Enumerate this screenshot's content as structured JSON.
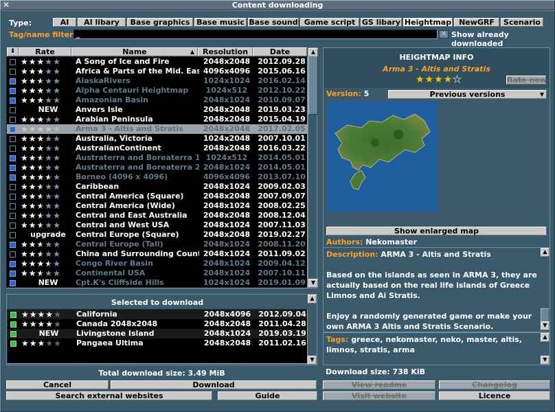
{
  "window": {
    "title": "Content downloading",
    "close_glyph": "✕"
  },
  "filter": {
    "type_label": "Type:",
    "types": [
      {
        "label": "AI",
        "selected": false
      },
      {
        "label": "AI libary",
        "selected": false
      },
      {
        "label": "Base graphics",
        "selected": false
      },
      {
        "label": "Base music",
        "selected": false
      },
      {
        "label": "Base sound",
        "selected": false
      },
      {
        "label": "Game script",
        "selected": false
      },
      {
        "label": "GS libary",
        "selected": false
      },
      {
        "label": "Heightmap",
        "selected": true
      },
      {
        "label": "NewGRF",
        "selected": false
      },
      {
        "label": "Scenario",
        "selected": false
      }
    ],
    "tag_label": "Tag/name filter:",
    "tag_value": "_",
    "show_downloaded_label": "Show already downloaded"
  },
  "list": {
    "columns": {
      "sort": "⬇",
      "rate": "Rate",
      "name": "Name",
      "resolution": "Resolution",
      "date": "Date"
    },
    "items": [
      {
        "checked": false,
        "status": "",
        "rating": 3,
        "name": "A Song of Ice and Fire",
        "resolution": "2048x2048",
        "date": "2012.09.28",
        "downloaded": false
      },
      {
        "checked": false,
        "status": "",
        "rating": 3,
        "name": "Africa & Parts of the Mid. East",
        "resolution": "4096x4096",
        "date": "2015.06.16",
        "downloaded": false
      },
      {
        "checked": true,
        "status": "",
        "rating": 2.5,
        "name": "AlaskaRivers",
        "resolution": "1024x1024",
        "date": "2016.02.14",
        "downloaded": true
      },
      {
        "checked": true,
        "status": "",
        "rating": 3,
        "name": "Alpha Centauri Heightmap",
        "resolution": "1024x512",
        "date": "2012.10.22",
        "downloaded": true
      },
      {
        "checked": true,
        "status": "",
        "rating": 3,
        "name": "Amazonian Basin",
        "resolution": "2048x1024",
        "date": "2010.09.07",
        "downloaded": true
      },
      {
        "checked": false,
        "status": "NEW",
        "rating": 0,
        "name": "Anvers Isle",
        "resolution": "2048x2048",
        "date": "2019.03.23",
        "downloaded": false
      },
      {
        "checked": false,
        "status": "",
        "rating": 3,
        "name": "Arabian Peninsula",
        "resolution": "2048x2048",
        "date": "2015.04.19",
        "downloaded": false
      },
      {
        "checked": true,
        "status": "",
        "rating": 4,
        "name": "Arma 3 - Altis and Stratis",
        "resolution": "2048x2048",
        "date": "2017.02.05",
        "downloaded": true,
        "selected": true
      },
      {
        "checked": false,
        "status": "",
        "rating": 3,
        "name": "Australia, Victoria",
        "resolution": "1024x2048",
        "date": "2007.10.01",
        "downloaded": false
      },
      {
        "checked": false,
        "status": "",
        "rating": 3,
        "name": "AustralianContinent",
        "resolution": "2048x2048",
        "date": "2016.03.22",
        "downloaded": false
      },
      {
        "checked": true,
        "status": "",
        "rating": 2.5,
        "name": "Austraterra and Boreaterra 1k",
        "resolution": "1024x512",
        "date": "2014.05.01",
        "downloaded": true
      },
      {
        "checked": true,
        "status": "",
        "rating": 2.5,
        "name": "Austraterra and Boreaterra 2k",
        "resolution": "2048x1024",
        "date": "2014.05.01",
        "downloaded": true
      },
      {
        "checked": true,
        "status": "",
        "rating": 3.5,
        "name": "Borneo (4096 x 4096)",
        "resolution": "4096x4096",
        "date": "2013.07.10",
        "downloaded": true
      },
      {
        "checked": false,
        "status": "",
        "rating": 2.5,
        "name": "Caribbean",
        "resolution": "2048x1024",
        "date": "2009.02.03",
        "downloaded": false
      },
      {
        "checked": false,
        "status": "",
        "rating": 2.5,
        "name": "Central America (Square)",
        "resolution": "2048x2048",
        "date": "2007.09.07",
        "downloaded": false
      },
      {
        "checked": false,
        "status": "",
        "rating": 2.5,
        "name": "Central America (Wide)",
        "resolution": "2048x1024",
        "date": "2008.02.25",
        "downloaded": false
      },
      {
        "checked": false,
        "status": "",
        "rating": 2.5,
        "name": "Central and East Australia",
        "resolution": "2048x2048",
        "date": "2008.12.04",
        "downloaded": false
      },
      {
        "checked": false,
        "status": "",
        "rating": 2.5,
        "name": "Central and West USA",
        "resolution": "2048x1024",
        "date": "2007.11.03",
        "downloaded": false
      },
      {
        "checked": false,
        "status": "upgrade",
        "rating": 0,
        "name": "Central Europe (Square)",
        "resolution": "2048x2048",
        "date": "2019.02.27",
        "downloaded": false
      },
      {
        "checked": true,
        "status": "",
        "rating": 2.5,
        "name": "Central Europe (Tall)",
        "resolution": "2048x1024",
        "date": "2008.11.20",
        "downloaded": true
      },
      {
        "checked": false,
        "status": "",
        "rating": 2.5,
        "name": "China and Surrounding Countries",
        "resolution": "2048x1024",
        "date": "2011.09.02",
        "downloaded": false
      },
      {
        "checked": true,
        "status": "",
        "rating": 3.5,
        "name": "Congo River Basin",
        "resolution": "2048x1024",
        "date": "2009.04.12",
        "downloaded": true
      },
      {
        "checked": true,
        "status": "",
        "rating": 2.5,
        "name": "Continental USA",
        "resolution": "2048x1024",
        "date": "2007.10.11",
        "downloaded": true
      },
      {
        "checked": true,
        "status": "NEW",
        "rating": 0,
        "name": "Cpt.K's Cliffside Hills",
        "resolution": "1024x1024",
        "date": "2019.01.09",
        "downloaded": true
      }
    ]
  },
  "selected_panel": {
    "title": "Selected to download",
    "items": [
      {
        "status": "",
        "rating": 4,
        "name": "California",
        "resolution": "2048x4096",
        "date": "2012.09.04"
      },
      {
        "status": "",
        "rating": 4,
        "name": "Canada 2048x2048",
        "resolution": "2048x2048",
        "date": "2011.04.28"
      },
      {
        "status": "NEW",
        "rating": 0,
        "name": "Livingstone Island",
        "resolution": "2048x1024",
        "date": "2019.03.19"
      },
      {
        "status": "",
        "rating": 3,
        "name": "Pangaea Ultima",
        "resolution": "2048x2048",
        "date": "2011.02.16"
      }
    ],
    "total_label": "Total download size: 3.49 MiB"
  },
  "info": {
    "heading": "HEIGHTMAP INFO",
    "name": "Arma 3 - Altis and Stratis",
    "rating": 4,
    "rate_button": "Rate now",
    "version_label": "Version:",
    "version_value": "5",
    "previous_versions": "Previous versions",
    "enlarge_button": "Show enlarged map",
    "authors_label": "Authors:",
    "authors_value": "Nekomaster",
    "description_label": "Description:",
    "description_title": "ARMA 3 - Altis and Stratis",
    "description_p1": "Based on the islands as seen in ARMA 3, they are actually based on the real life islands of Greece Limnos and Ai Stratis.",
    "description_p2": "Enjoy a randomly generated game or make your own ARMA 3 Altis and Stratis Scenario.",
    "tags_label": "Tags:",
    "tags_value": "greece, nekomaster, neko, master, altis, limnos, stratis, arma",
    "download_size": "Download size: 738 KiB"
  },
  "buttons": {
    "cancel": "Cancel",
    "download": "Download",
    "search_external": "Search external websites",
    "guide": "Guide",
    "view_readme": "View readme",
    "changelog": "Changelog",
    "visit_website": "Visit website",
    "licence": "Licence"
  },
  "colors": {
    "panel": "#3a5a6c",
    "highlight": "#ff9f2a",
    "star_filled": "#ffffff",
    "star_empty": "#7f97a6",
    "star_info": "#f2c200",
    "new_tag": "#ffffff",
    "dim_text": "#5f7c8c"
  }
}
